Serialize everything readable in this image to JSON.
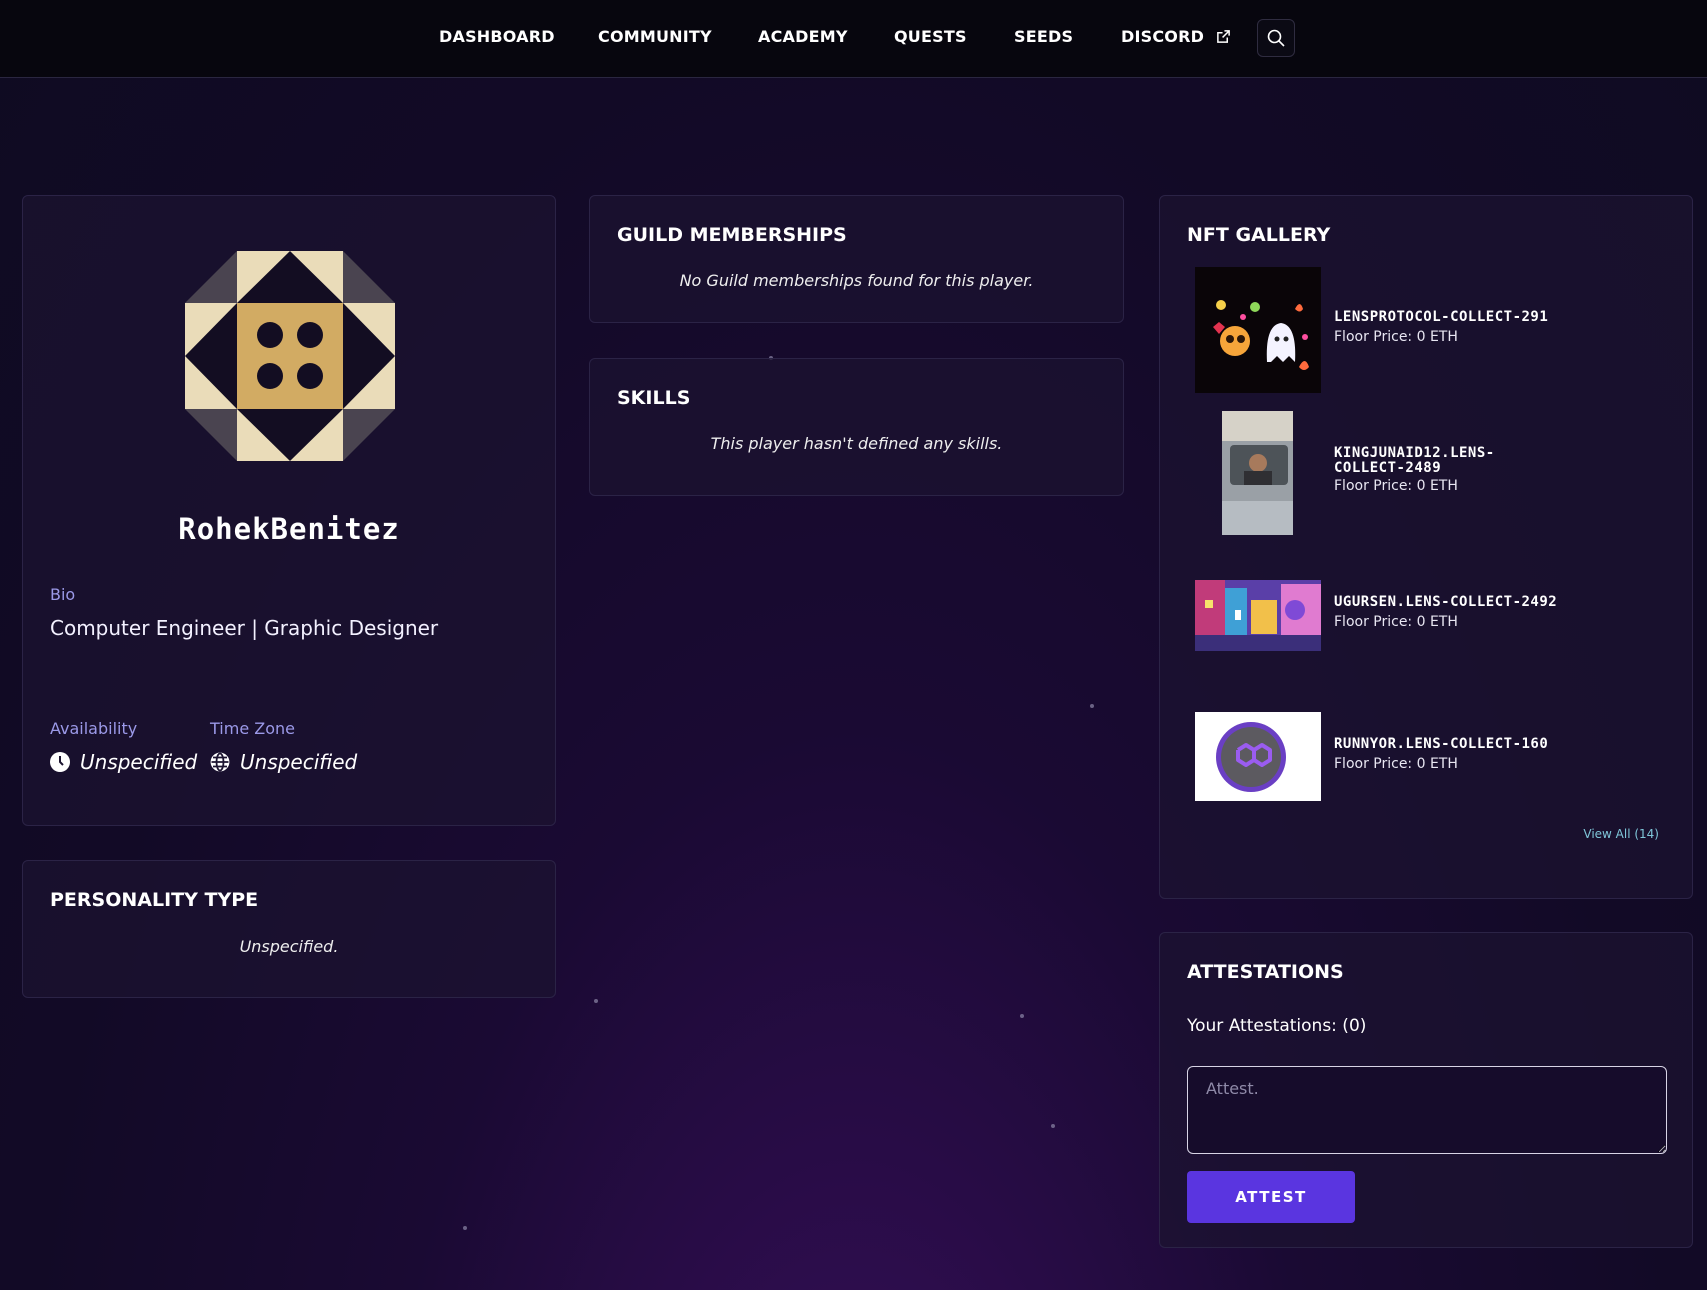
{
  "nav": {
    "items": [
      "DASHBOARD",
      "COMMUNITY",
      "ACADEMY",
      "QUESTS",
      "SEEDS",
      "DISCORD"
    ]
  },
  "profile": {
    "name": "RohekBenitez",
    "bio_label": "Bio",
    "bio": "Computer Engineer | Graphic Designer",
    "availability_label": "Availability",
    "availability_value": "Unspecified",
    "timezone_label": "Time Zone",
    "timezone_value": "Unspecified"
  },
  "personality": {
    "title": "PERSONALITY TYPE",
    "value": "Unspecified."
  },
  "guilds": {
    "title": "GUILD MEMBERSHIPS",
    "empty": "No Guild memberships found for this player."
  },
  "skills": {
    "title": "SKILLS",
    "empty": "This player hasn't defined any skills."
  },
  "nft_gallery": {
    "title": "NFT GALLERY",
    "items": [
      {
        "name": "lensprotocol-Collect-291",
        "price": "Floor Price: 0 ETH"
      },
      {
        "name": "kingjunaid12.lens-Collect-2489",
        "price": "Floor Price: 0 ETH"
      },
      {
        "name": "ugursen.lens-Collect-2492",
        "price": "Floor Price: 0 ETH"
      },
      {
        "name": "runnyor.lens-Collect-160",
        "price": "Floor Price: 0 ETH"
      }
    ],
    "view_all": "View All (14)"
  },
  "attestations": {
    "title": "ATTESTATIONS",
    "count_text": "Your Attestations: (0)",
    "input_placeholder": "Attest.",
    "button_label": "ATTEST"
  },
  "colors": {
    "accent_button": "#5a35e0",
    "label_purple": "#9b99e8",
    "link_cyan": "#7fc6d9",
    "avatar_cream": "#eadcb9",
    "avatar_gold": "#d2ab63"
  }
}
